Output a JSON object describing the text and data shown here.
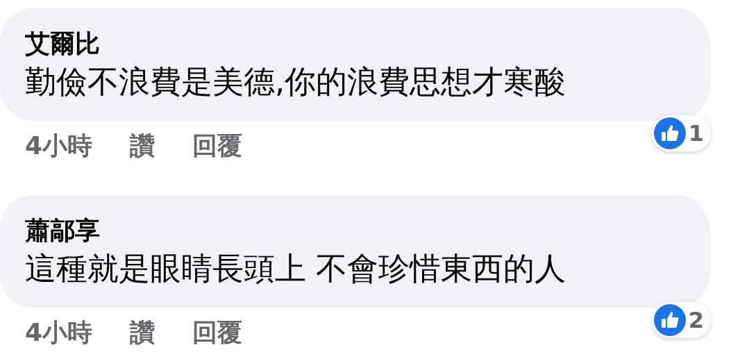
{
  "comments": [
    {
      "author": "艾爾比",
      "text": "勤儉不浪費是美德,你的浪費思想才寒酸",
      "time": "4小時",
      "like": "讚",
      "reply": "回覆",
      "reaction_count": "1"
    },
    {
      "author": "蕭鄗享",
      "text": "這種就是眼睛長頭上 不會珍惜東西的人",
      "time": "4小時",
      "like": "讚",
      "reply": "回覆",
      "reaction_count": "2"
    }
  ]
}
